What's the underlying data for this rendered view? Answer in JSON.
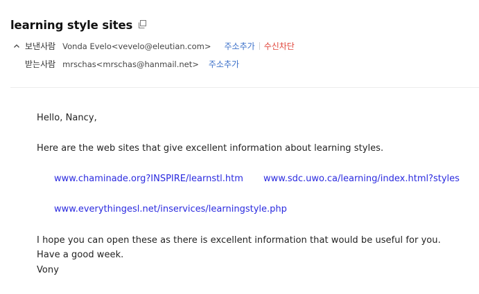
{
  "mail": {
    "subject": "learning style sites",
    "from_label": "보낸사람",
    "from_value": "Vonda Evelo<vevelo@eleutian.com>",
    "to_label": "받는사람",
    "to_value": "mrschas<mrschas@hanmail.net>",
    "add_address_label": "주소추가",
    "block_label": "수신차단"
  },
  "body": {
    "greeting": "Hello, Nancy,",
    "intro": "Here are the web sites that give excellent information about learning styles.",
    "links": [
      "www.chaminade.org?INSPIRE/learnstl.htm",
      "www.sdc.uwo.ca/learning/index.html?styles",
      "www.everythingesl.net/inservices/learningstyle.php"
    ],
    "closing_lines": [
      "I hope you can open these as there is excellent information that would be useful for you.",
      "Have a good week.",
      "Vony"
    ]
  },
  "colors": {
    "link": "#2a2adf",
    "action_blue": "#3a6fc9",
    "action_red": "#e0453a"
  },
  "icons": {
    "copy": "copy-icon",
    "toggle": "chevron-up-icon"
  }
}
